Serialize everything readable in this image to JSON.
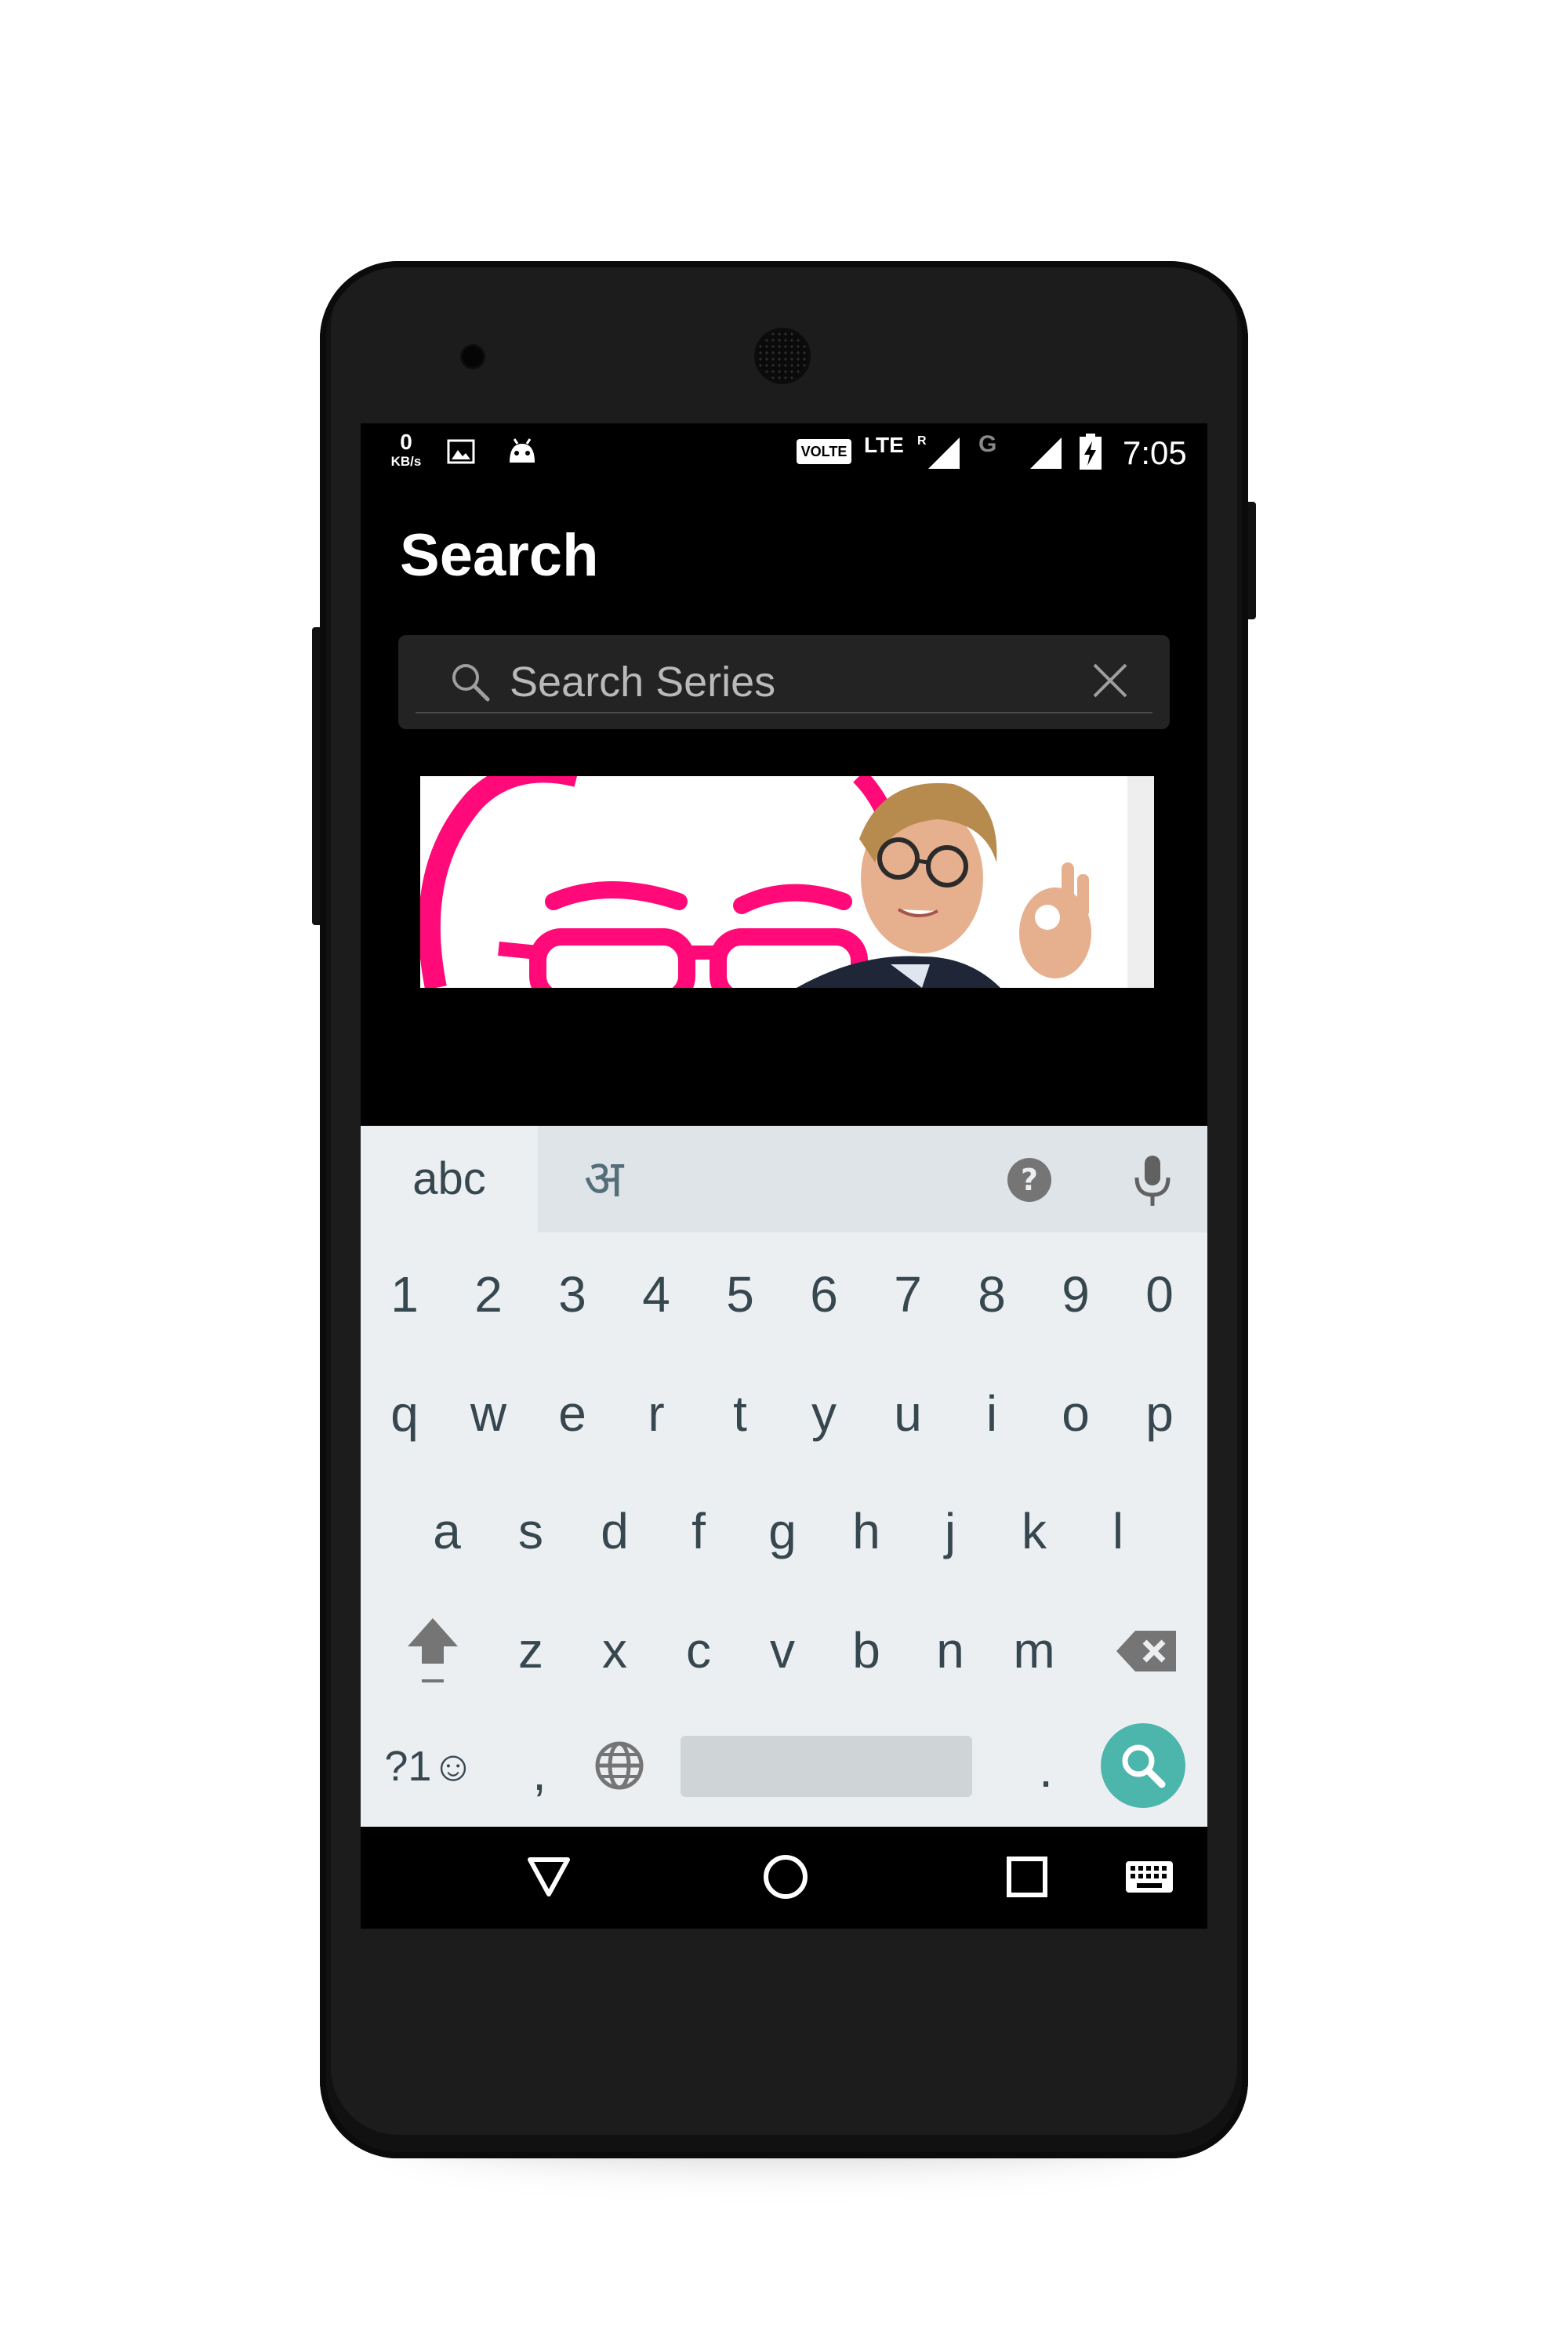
{
  "status_bar": {
    "speed_value": "0",
    "speed_unit": "KB/s",
    "volte_label": "VOLTE",
    "lte_label": "LTE",
    "roaming_label": "R",
    "network_g_label": "G",
    "time": "7:05",
    "icons": [
      "image-icon",
      "android-icon",
      "signal-icon",
      "battery-charging-icon"
    ]
  },
  "page": {
    "title": "Search"
  },
  "search": {
    "placeholder": "Search Series",
    "value": "",
    "icon": "search-icon",
    "clear_icon": "close-icon"
  },
  "banner": {
    "image": "show-banner-image",
    "colors": {
      "accent": "#ff0a78"
    }
  },
  "keyboard": {
    "tab_abc": "abc",
    "tab_hindi": "अ",
    "help_icon": "help-icon",
    "mic_icon": "mic-icon",
    "number_row": [
      "1",
      "2",
      "3",
      "4",
      "5",
      "6",
      "7",
      "8",
      "9",
      "0"
    ],
    "row1": [
      "q",
      "w",
      "e",
      "r",
      "t",
      "y",
      "u",
      "i",
      "o",
      "p"
    ],
    "row2": [
      "a",
      "s",
      "d",
      "f",
      "g",
      "h",
      "j",
      "k",
      "l"
    ],
    "row3": [
      "z",
      "x",
      "c",
      "v",
      "b",
      "n",
      "m"
    ],
    "symbols_key": "?1☺",
    "comma_key": ",",
    "period_key": ".",
    "globe_icon": "globe-icon",
    "shift_icon": "shift-icon",
    "backspace_icon": "backspace-icon",
    "search_key_icon": "search-icon",
    "colors": {
      "search_key": "#4db6ac",
      "key_text": "#37474f"
    }
  },
  "nav_bar": {
    "icons": [
      "back-icon",
      "home-icon",
      "recents-icon",
      "keyboard-icon"
    ]
  }
}
